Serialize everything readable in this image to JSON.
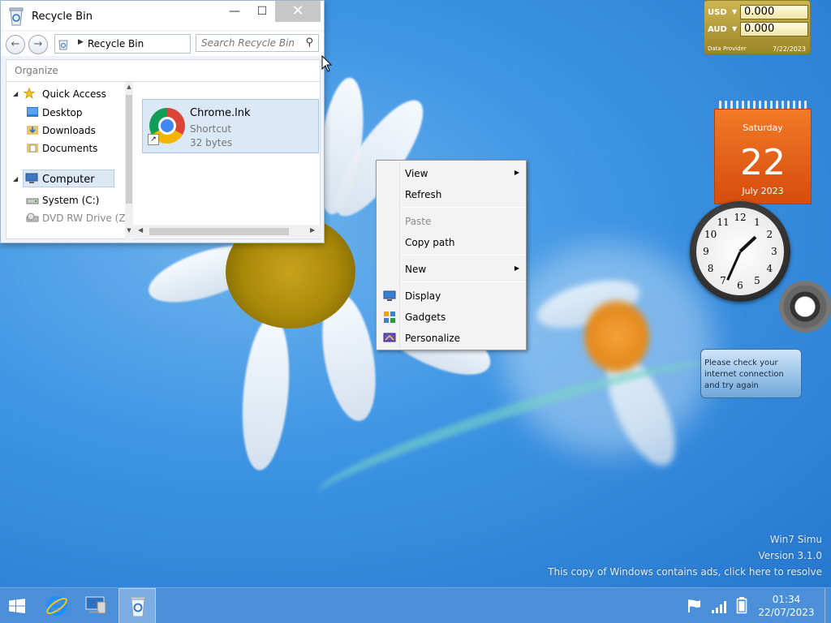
{
  "explorer": {
    "title": "Recycle Bin",
    "window_controls": {
      "minimize": "—",
      "maximize": "☐",
      "close": "✕"
    },
    "nav": {
      "back": "←",
      "forward": "→"
    },
    "address": "Recycle Bin",
    "search_placeholder": "Search Recycle Bin",
    "toolbar": {
      "organize": "Organize"
    },
    "tree": [
      {
        "label": "Quick Access",
        "icon": "star-icon"
      },
      {
        "label": "Desktop",
        "icon": "desktop-folder-icon"
      },
      {
        "label": "Downloads",
        "icon": "downloads-folder-icon"
      },
      {
        "label": "Documents",
        "icon": "documents-folder-icon"
      },
      {
        "label": "Computer",
        "icon": "computer-icon",
        "selected": true
      },
      {
        "label": "System (C:)",
        "icon": "drive-icon"
      },
      {
        "label": "DVD RW Drive (Z:)",
        "icon": "dvd-drive-icon"
      }
    ],
    "files": [
      {
        "name": "Chrome.lnk",
        "type": "Shortcut",
        "size": "32 bytes",
        "icon": "chrome-icon"
      }
    ]
  },
  "context_menu": {
    "items": [
      {
        "label": "View",
        "submenu": true
      },
      {
        "label": "Refresh"
      },
      {
        "label": "Paste",
        "disabled": true
      },
      {
        "label": "Copy path"
      },
      {
        "label": "New",
        "submenu": true
      },
      {
        "label": "Display",
        "icon": "display-icon"
      },
      {
        "label": "Gadgets",
        "icon": "gadgets-icon"
      },
      {
        "label": "Personalize",
        "icon": "personalize-icon"
      }
    ]
  },
  "gadgets": {
    "currency": {
      "rows": [
        {
          "code": "USD",
          "value": "0.000"
        },
        {
          "code": "AUD",
          "value": "0.000"
        }
      ],
      "provider": "Data Provider",
      "date": "7/22/2023"
    },
    "calendar": {
      "weekday": "Saturday",
      "day": "22",
      "month_year": "July 2023"
    },
    "clock": {
      "numbers": [
        "12",
        "1",
        "2",
        "3",
        "4",
        "5",
        "6",
        "7",
        "8",
        "9",
        "10",
        "11"
      ],
      "hour": 1,
      "minute": 34
    },
    "weather": {
      "message": "Please check your internet connection and try again"
    }
  },
  "watermark": {
    "line1": "Win7 Simu",
    "line2": "Version 3.1.0",
    "line3": "This copy of Windows contains ads, click here to resolve"
  },
  "taskbar": {
    "buttons": [
      {
        "name": "start",
        "icon": "windows-logo-icon"
      },
      {
        "name": "internet-explorer",
        "icon": "internet-explorer-icon"
      },
      {
        "name": "computer",
        "icon": "computer-icon"
      },
      {
        "name": "recycle-bin",
        "icon": "recycle-bin-icon",
        "active": true
      }
    ],
    "tray": {
      "time": "01:34",
      "date": "22/07/2023"
    }
  }
}
